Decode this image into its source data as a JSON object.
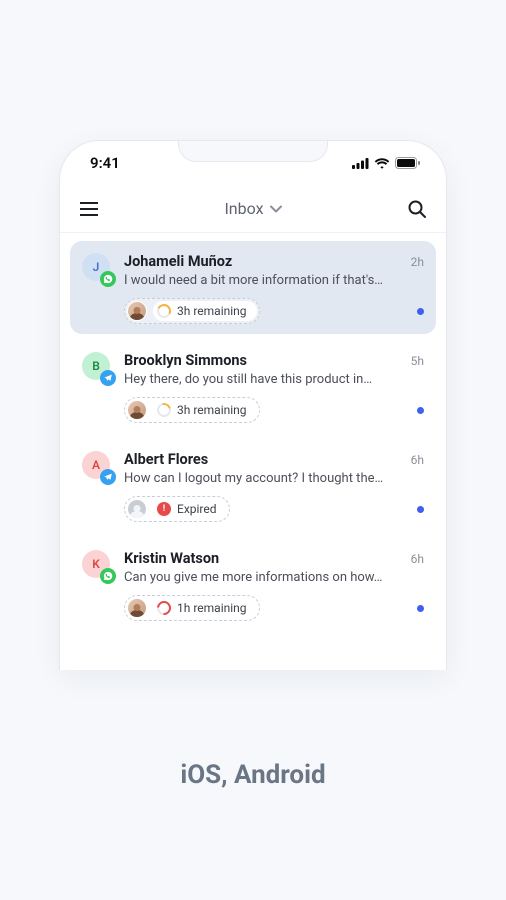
{
  "status_bar": {
    "time": "9:41"
  },
  "nav": {
    "title": "Inbox"
  },
  "conversations": [
    {
      "initial": "J",
      "name": "Johameli Muñoz",
      "time": "2h",
      "preview": "I would need a bit more information if that's…",
      "sla_label": "3h remaining"
    },
    {
      "initial": "B",
      "name": "Brooklyn Simmons",
      "time": "5h",
      "preview": "Hey there, do you still have this product in…",
      "sla_label": "3h remaining"
    },
    {
      "initial": "A",
      "name": "Albert Flores",
      "time": "6h",
      "preview": "How can I logout my account? I thought the…",
      "sla_label": "Expired"
    },
    {
      "initial": "K",
      "name": "Kristin Watson",
      "time": "6h",
      "preview": "Can you give me more informations on how…",
      "sla_label": "1h remaining"
    }
  ],
  "caption": "iOS, Android"
}
